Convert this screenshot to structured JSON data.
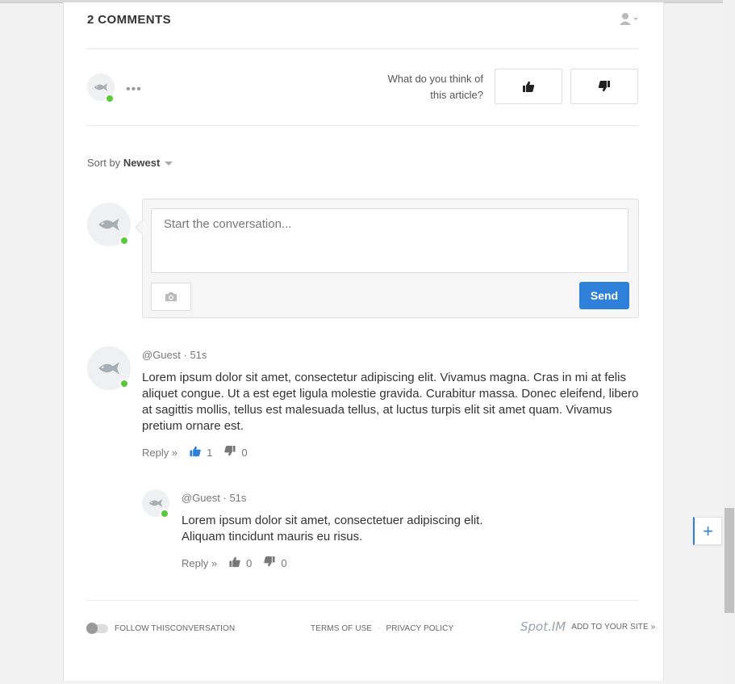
{
  "header": {
    "title": "2 COMMENTS",
    "user_menu_icon": "user-dropdown-icon"
  },
  "rating": {
    "question": "What do you think of this article?",
    "like_icon": "thumbs-up-icon",
    "dislike_icon": "thumbs-down-icon",
    "more_icon": "ellipsis-icon"
  },
  "sort": {
    "label": "Sort by",
    "value": "Newest"
  },
  "composer": {
    "placeholder": "Start the conversation...",
    "camera_icon": "camera-icon",
    "send_label": "Send",
    "send_color": "#2f80d8"
  },
  "comments": [
    {
      "author": "@Guest",
      "time": "51s",
      "text": "Lorem ipsum dolor sit amet, consectetur adipiscing elit. Vivamus magna. Cras in mi at felis aliquet congue. Ut a est eget ligula molestie gravida. Curabitur massa. Donec eleifend, libero at sagittis mollis, tellus est malesuada tellus, at luctus turpis elit sit amet quam. Vivamus pretium ornare est.",
      "reply_label": "Reply »",
      "likes": "1",
      "dislikes": "0"
    },
    {
      "author": "@Guest",
      "time": "51s",
      "text_line1": "Lorem ipsum dolor sit amet, consectetuer adipiscing elit.",
      "text_line2": "Aliquam tincidunt mauris eu risus.",
      "reply_label": "Reply »",
      "likes": "0",
      "dislikes": "0"
    }
  ],
  "footer": {
    "follow_label": "FOLLOW THISCONVERSATION",
    "terms": "TERMS OF USE",
    "privacy": "PRIVACY POLICY",
    "brand": "Spot.IM",
    "add_to_site": "ADD TO YOUR SITE »"
  },
  "floating": {
    "plus_label": "+"
  },
  "colors": {
    "online": "#57c93a",
    "accent": "#2f80d8"
  }
}
